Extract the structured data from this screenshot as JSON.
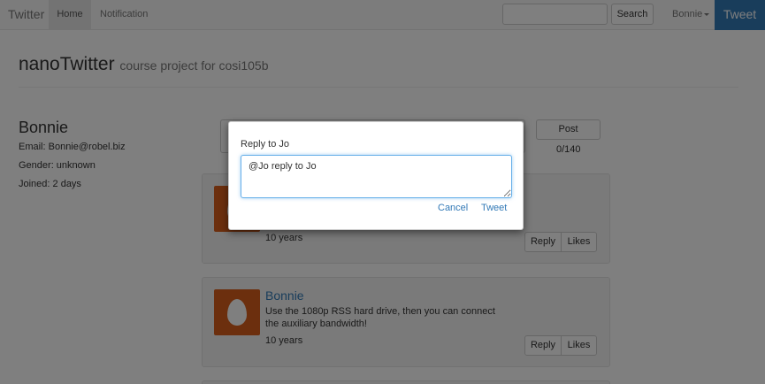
{
  "navbar": {
    "brand": "Twitter",
    "home_label": "Home",
    "notification_label": "Notification",
    "search_value": "",
    "search_button_label": "Search",
    "user_label": "Bonnie",
    "tweet_button_label": "Tweet",
    "accent_color": "#337ab7"
  },
  "header": {
    "title": "nanoTwitter",
    "subtitle": "course project for cosi105b"
  },
  "profile": {
    "name": "Bonnie",
    "email": "Email: Bonnie@robel.biz",
    "gender": "Gender: unknown",
    "joined": "Joined: 2 days"
  },
  "compose": {
    "post_label": "Post",
    "counter": "0/140"
  },
  "tweets": [
    {
      "author": "",
      "text": "",
      "time": "10 years",
      "reply_label": "Reply",
      "likes_label": "Likes"
    },
    {
      "author": "Bonnie",
      "text": "Use the 1080p RSS hard drive, then you can connect the auxiliary bandwidth!",
      "time": "10 years",
      "reply_label": "Reply",
      "likes_label": "Likes"
    }
  ],
  "modal": {
    "label": "Reply to Jo",
    "textarea_value": "@Jo reply to Jo",
    "cancel_label": "Cancel",
    "tweet_label": "Tweet"
  }
}
